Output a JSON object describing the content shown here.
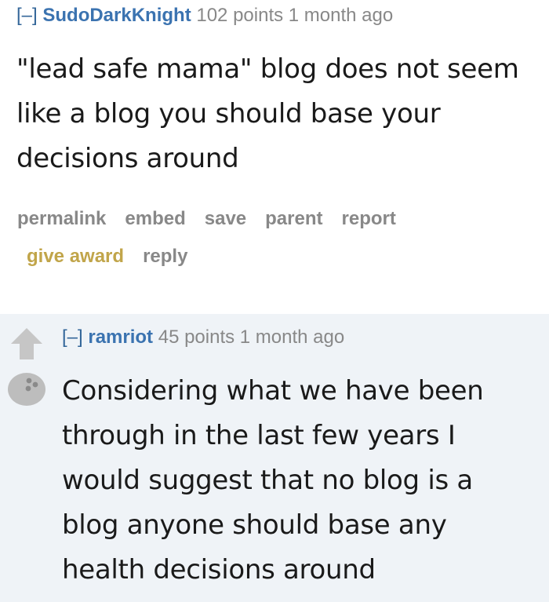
{
  "parent_comment": {
    "collapse": "[–]",
    "author": "SudoDarkKnight",
    "meta": "102 points 1 month ago",
    "body_lines": [
      "\"lead safe mama\" blog does not seem",
      "like a blog you should base your",
      "decisions around"
    ],
    "buttons": {
      "permalink": "permalink",
      "embed": "embed",
      "save": "save",
      "parent": "parent",
      "report": "report",
      "give_award": "give award",
      "reply": "reply"
    }
  },
  "child_comment": {
    "collapse": "[–]",
    "author": "ramriot",
    "meta": "45 points 1 month ago",
    "body_lines": [
      "Considering what we have been",
      "through in the last few years I",
      "would suggest that no blog is a",
      "blog anyone should base any",
      "health decisions around"
    ]
  },
  "icons": {
    "upvote": "upvote-arrow-icon",
    "avatar": "bowling-ball-avatar-icon"
  },
  "colors": {
    "author": "#3b73b0",
    "award": "#c1a54a",
    "muted": "#888888",
    "child_bg": "#eff3f7"
  }
}
